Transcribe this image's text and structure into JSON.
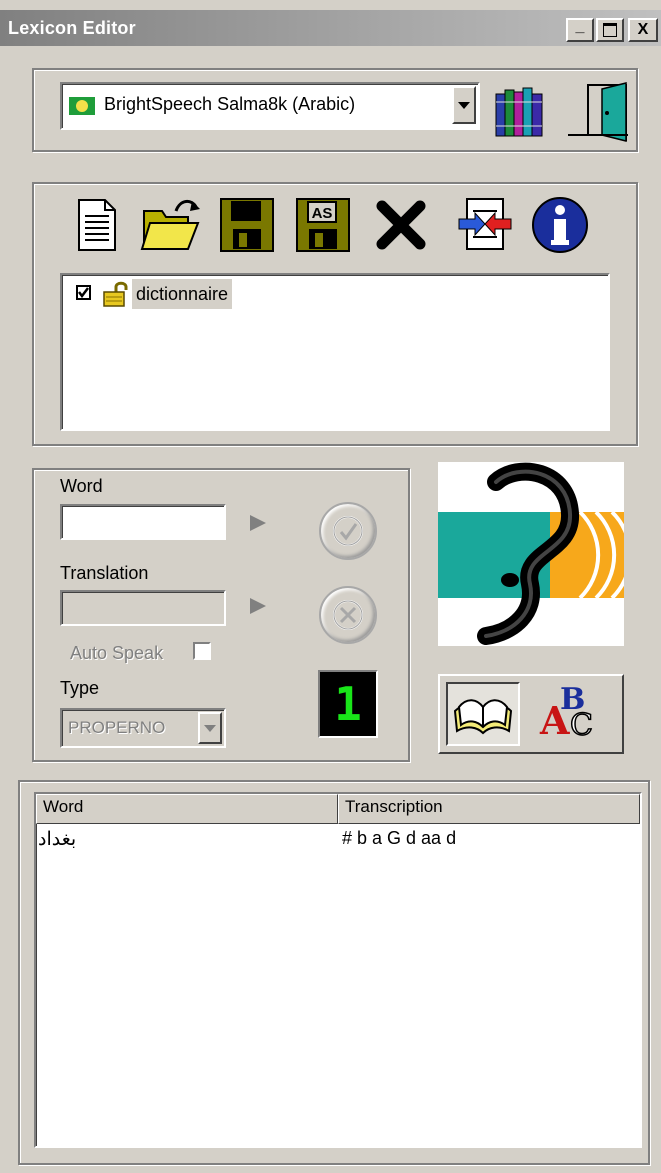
{
  "window": {
    "title": "Lexicon Editor",
    "controls": {
      "minimize": "_",
      "maximize": "□",
      "close": "X"
    }
  },
  "voice": {
    "selected": "BrightSpeech Salma8k (Arabic)",
    "icons": [
      "flag-icon",
      "books-icon",
      "exit-door-icon"
    ]
  },
  "toolbar": {
    "icons": [
      "new-document-icon",
      "open-folder-icon",
      "save-icon",
      "save-as-icon",
      "delete-icon",
      "import-icon",
      "info-icon"
    ],
    "save_as_glyph": "AS"
  },
  "dictionaries": [
    {
      "name": "dictionnaire",
      "checked": true,
      "locked": false
    }
  ],
  "entry": {
    "word_label": "Word",
    "word_value": "",
    "translation_label": "Translation",
    "translation_value": "",
    "auto_speak_label": "Auto Speak",
    "auto_speak_checked": false,
    "type_label": "Type",
    "type_value": "PROPERNO",
    "counter_value": "1"
  },
  "mode_icons": {
    "dictionary_glyph": "",
    "spell_glyph_a": "A",
    "spell_glyph_b": "B",
    "spell_glyph_c": "C"
  },
  "word_list": {
    "columns": [
      "Word",
      "Transcription"
    ],
    "rows": [
      {
        "word": "بغداد",
        "transcription": "# b a G d aa d"
      }
    ]
  },
  "colors": {
    "title_gradient_start": "#808080",
    "face": "#d4d0c8",
    "teal": "#1aa89b",
    "orange": "#f7a81b",
    "lcd_green": "#19e619"
  }
}
